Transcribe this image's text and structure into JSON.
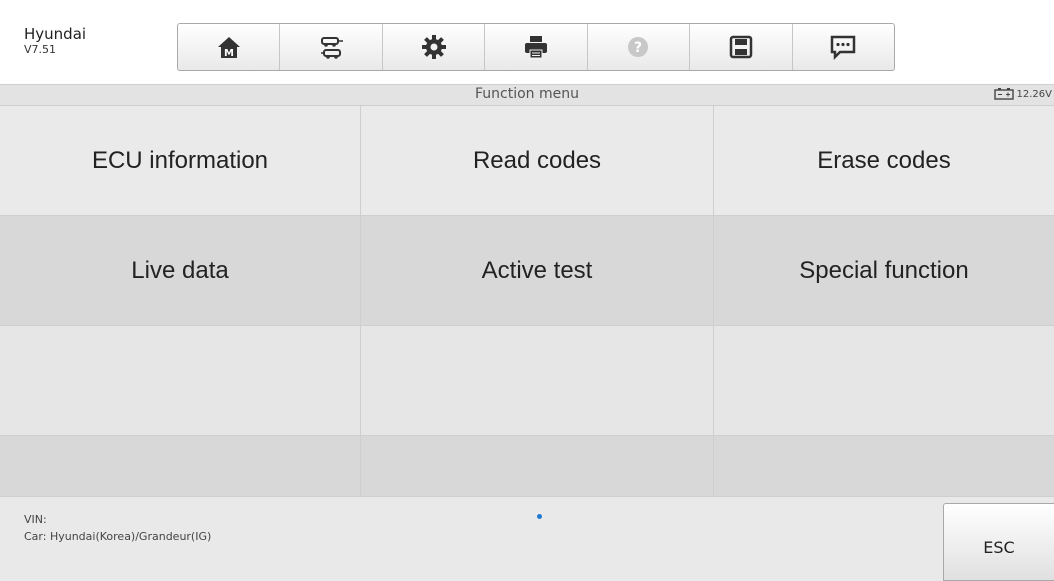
{
  "header": {
    "brand": "Hyundai",
    "version": "V7.51"
  },
  "toolbar": {
    "buttons": [
      {
        "icon": "home-icon"
      },
      {
        "icon": "vehicle-swap-icon"
      },
      {
        "icon": "settings-gear-icon"
      },
      {
        "icon": "print-icon"
      },
      {
        "icon": "help-icon"
      },
      {
        "icon": "save-icon"
      },
      {
        "icon": "message-icon"
      }
    ]
  },
  "titlebar": {
    "title": "Function menu",
    "voltage": "12.26V"
  },
  "menu": {
    "items": [
      {
        "label": "ECU information"
      },
      {
        "label": "Read codes"
      },
      {
        "label": "Erase codes"
      },
      {
        "label": "Live data"
      },
      {
        "label": "Active test"
      },
      {
        "label": "Special function"
      }
    ]
  },
  "footer": {
    "vin_label": "VIN:",
    "car_info": "Car: Hyundai(Korea)/Grandeur(IG)",
    "esc_label": "ESC"
  },
  "colors": {
    "accent_dot": "#1e78d6",
    "icon_dark": "#333333",
    "icon_disabled": "#c8c8c8"
  }
}
